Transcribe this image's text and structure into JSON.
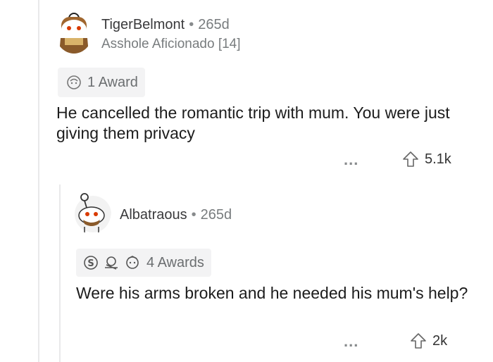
{
  "comment1": {
    "username": "TigerBelmont",
    "separator": "•",
    "age": "265d",
    "flair": "Asshole Aficionado [14]",
    "awards_label": "1 Award",
    "body": "He cancelled the romantic trip with mum. You were just giving them privacy",
    "more": "...",
    "votes": "5.1k"
  },
  "comment2": {
    "username": "Albatraous",
    "separator": "•",
    "age": "265d",
    "awards_label": "4 Awards",
    "body": "Were his arms broken and he needed his mum's help?",
    "more": "...",
    "votes": "2k"
  }
}
